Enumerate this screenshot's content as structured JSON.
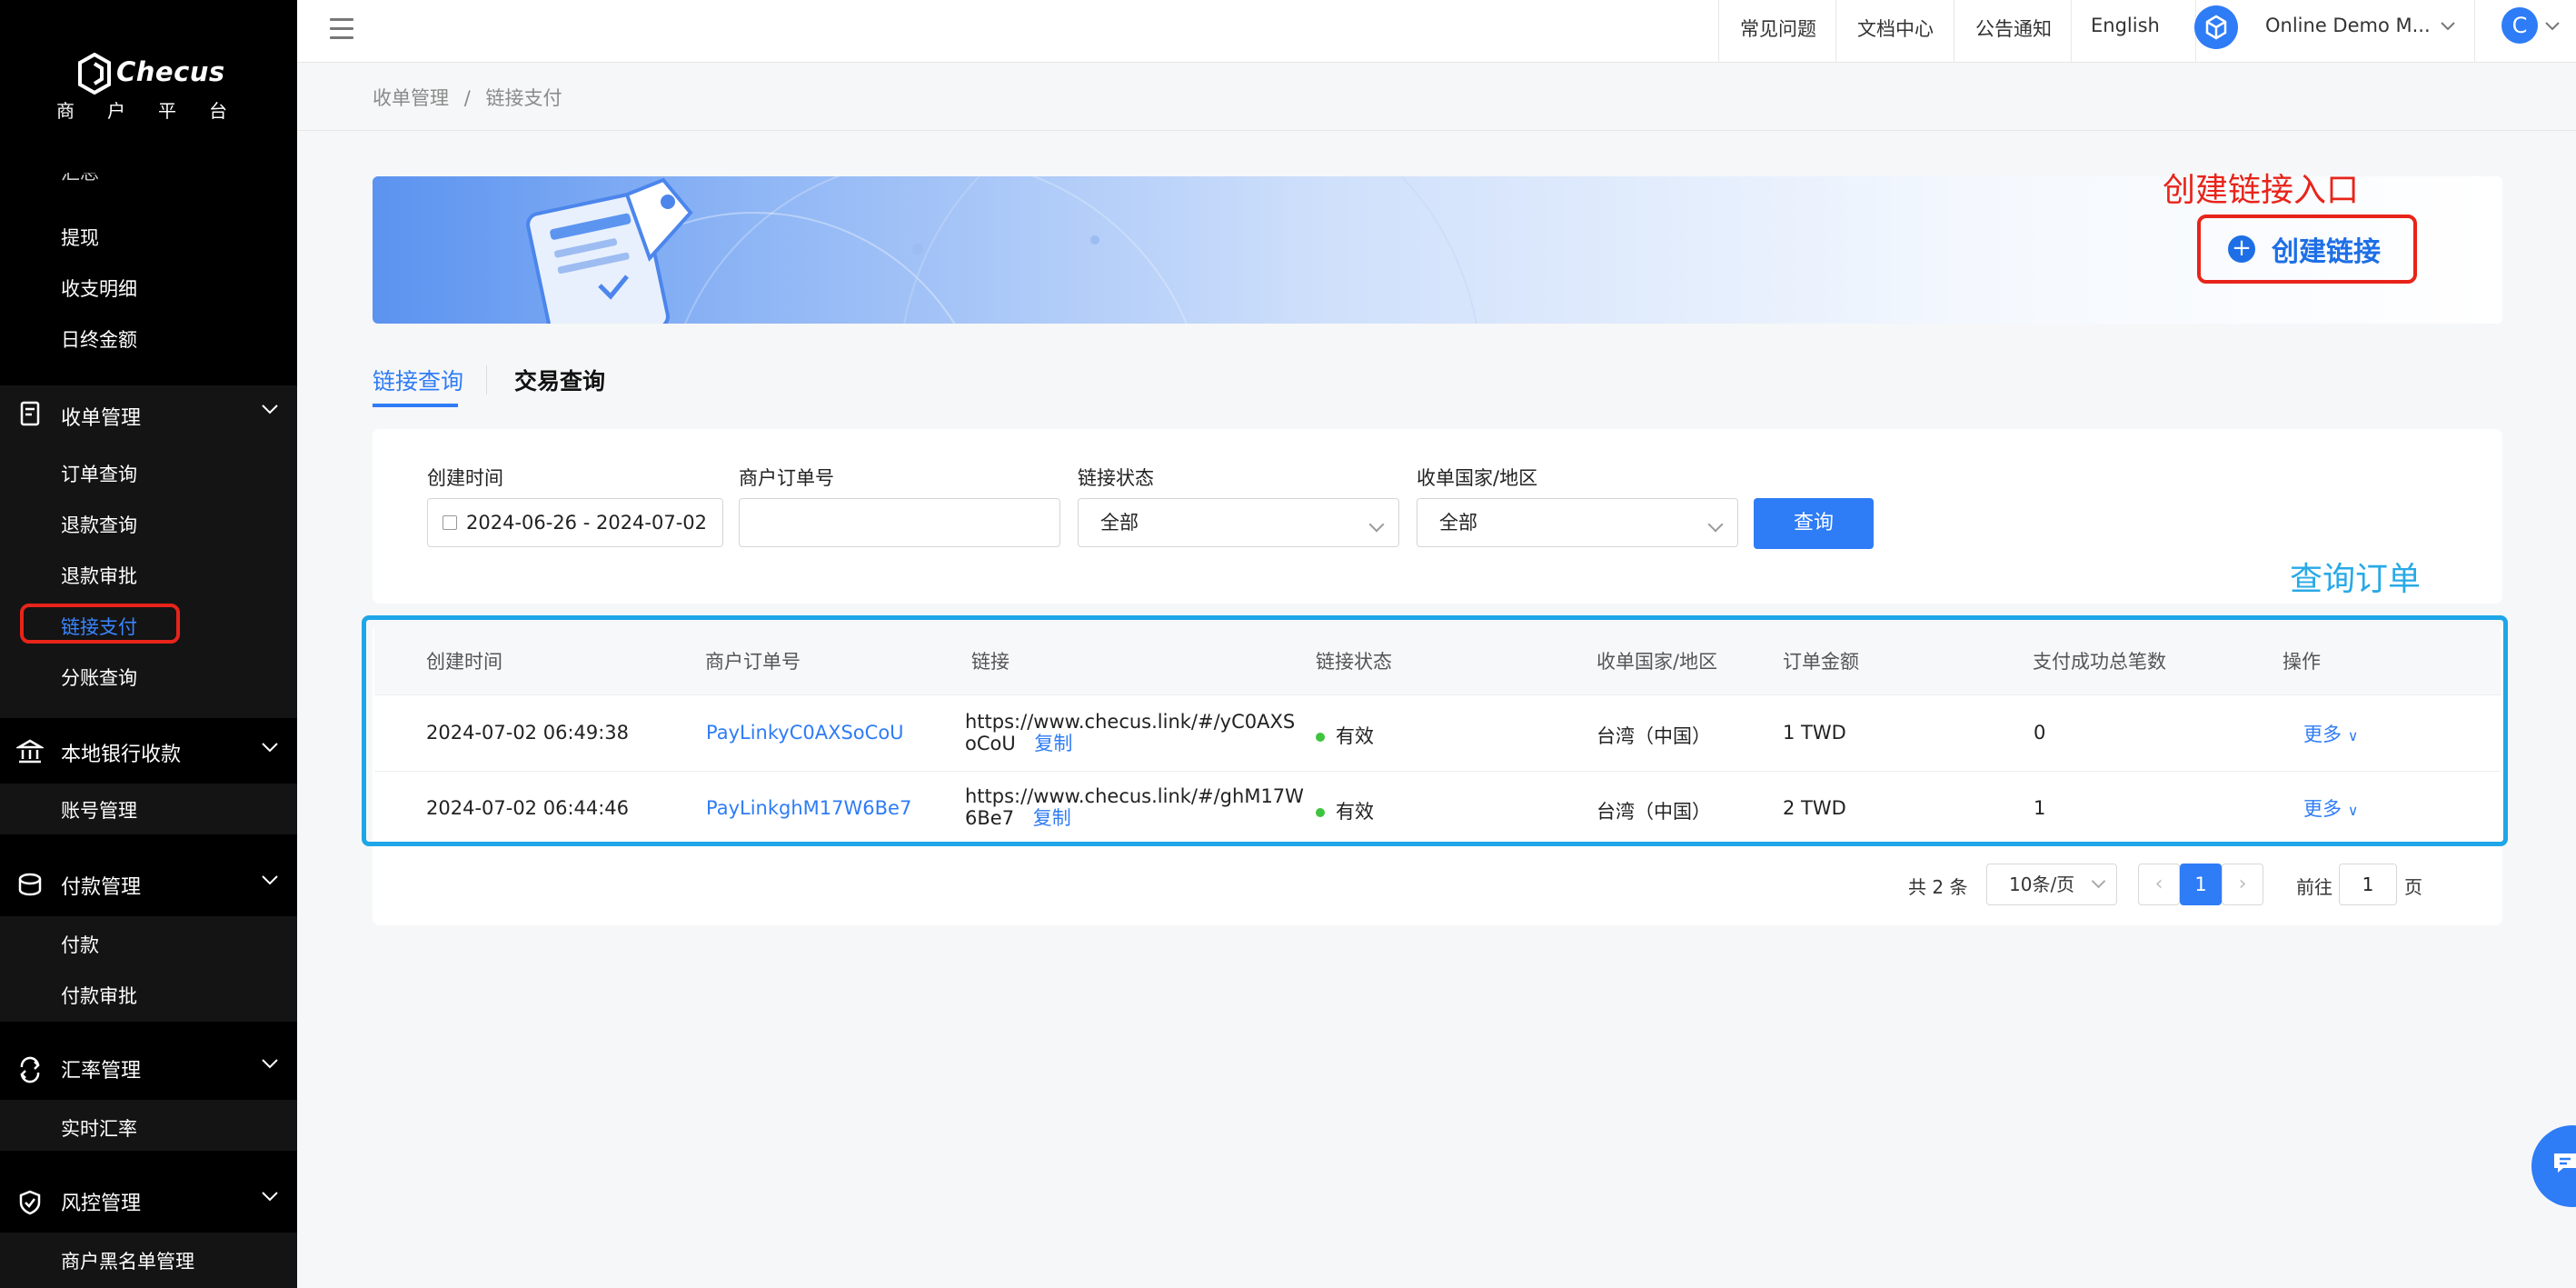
{
  "brand": {
    "name": "Checus",
    "subtitle": "商户平台"
  },
  "sidebar": {
    "partial_item": "汇总",
    "items_top": [
      "提现",
      "收支明细",
      "日终金额"
    ],
    "groups": [
      {
        "label": "收单管理",
        "icon": "receipt-icon",
        "items": [
          "订单查询",
          "退款查询",
          "退款审批",
          "链接支付",
          "分账查询"
        ]
      },
      {
        "label": "本地银行收款",
        "icon": "bank-icon",
        "items": [
          "账号管理"
        ]
      },
      {
        "label": "付款管理",
        "icon": "payment-icon",
        "items": [
          "付款",
          "付款审批"
        ]
      },
      {
        "label": "汇率管理",
        "icon": "exchange-icon",
        "items": [
          "实时汇率"
        ]
      },
      {
        "label": "风控管理",
        "icon": "shield-icon",
        "items": [
          "商户黑名单管理"
        ]
      }
    ],
    "active_item": "链接支付"
  },
  "topbar": {
    "links": [
      "常见问题",
      "文档中心",
      "公告通知",
      "English"
    ],
    "merchant": "Online Demo M...",
    "avatar_letter": "C"
  },
  "breadcrumb": {
    "parent": "收单管理",
    "separator": "/",
    "current": "链接支付"
  },
  "banner": {
    "create_button": "创建链接",
    "annotation": "创建链接入口"
  },
  "tabs": [
    "链接查询",
    "交易查询"
  ],
  "filters": {
    "created_time_label": "创建时间",
    "created_time_value": "2024-06-26 - 2024-07-02",
    "order_no_label": "商户订单号",
    "order_no_value": "",
    "status_label": "链接状态",
    "status_value": "全部",
    "country_label": "收单国家/地区",
    "country_value": "全部",
    "query_button": "查询",
    "annotation": "查询订单"
  },
  "table": {
    "headers": [
      "创建时间",
      "商户订单号",
      "链接",
      "链接状态",
      "收单国家/地区",
      "订单金额",
      "支付成功总笔数",
      "操作"
    ],
    "rows": [
      {
        "created": "2024-07-02 06:49:38",
        "order_no": "PayLinkyC0AXSoCoU",
        "link_line1": "https://www.checus.link/#/yC0AXS",
        "link_line2": "oCoU",
        "copy": "复制",
        "status": "有效",
        "country": "台湾（中国）",
        "amount": "1 TWD",
        "success_count": "0",
        "action": "更多"
      },
      {
        "created": "2024-07-02 06:44:46",
        "order_no": "PayLinkghM17W6Be7",
        "link_line1": "https://www.checus.link/#/ghM17W",
        "link_line2": "6Be7",
        "copy": "复制",
        "status": "有效",
        "country": "台湾（中国）",
        "amount": "2 TWD",
        "success_count": "1",
        "action": "更多"
      }
    ]
  },
  "pagination": {
    "total": "共 2 条",
    "page_size": "10条/页",
    "current_page": "1",
    "goto_label": "前往",
    "goto_value": "1",
    "page_unit": "页"
  },
  "colors": {
    "accent": "#2e7cf6",
    "annotation_red": "#e8241a",
    "annotation_blue": "#29a9e6",
    "status_green": "#3ec43e"
  }
}
